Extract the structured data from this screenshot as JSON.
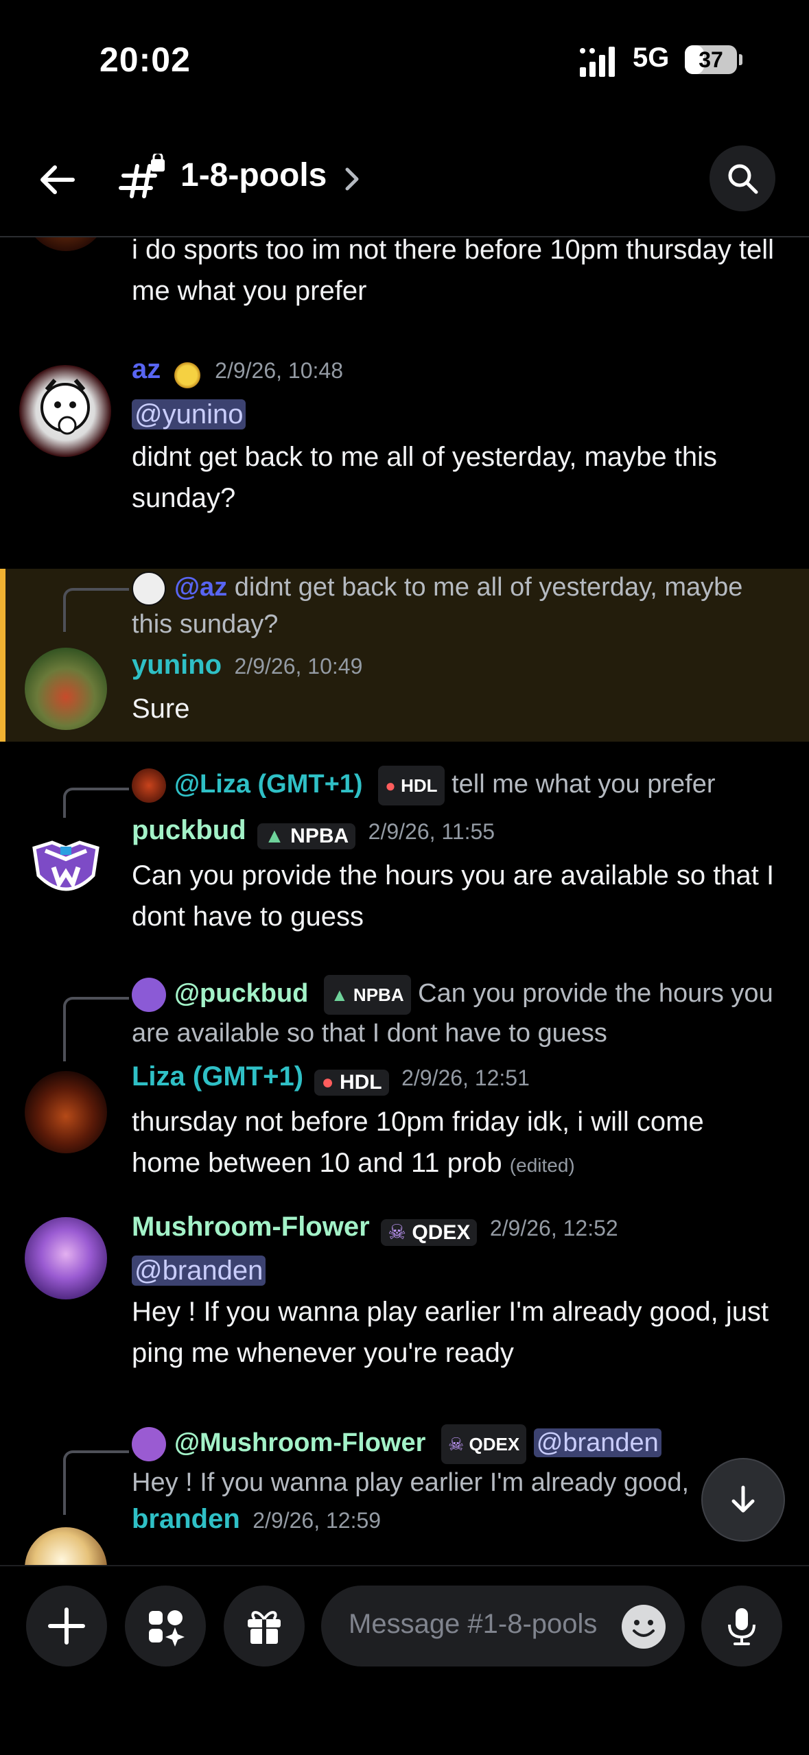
{
  "status_bar": {
    "time": "20:02",
    "network": "5G",
    "battery": "37",
    "battery_level": 0.37
  },
  "header": {
    "channel_name": "1-8-pools"
  },
  "colors": {
    "accent_yellow": "#f0b232",
    "mention_bg": "#3c4270",
    "name_teal": "#2fc0c6",
    "name_green": "#a3f2c8",
    "name_blue": "#5865f2"
  },
  "messages": [
    {
      "body": "i do sports too im not there before 10pm thursday tell me what you prefer"
    },
    {
      "author": "az",
      "timestamp": "2/9/26, 10:48",
      "mention": "@yunino",
      "body": "didnt get back to me all of yesterday, maybe this sunday?"
    },
    {
      "reply_to": "@az",
      "reply_text": "didnt get back to me all of yesterday, maybe this sunday?",
      "author": "yunino",
      "timestamp": "2/9/26, 10:49",
      "body": "Sure"
    },
    {
      "reply_to": "@Liza (GMT+1)",
      "reply_tag": "HDL",
      "reply_text": "tell me what you prefer",
      "author": "puckbud",
      "tag": "NPBA",
      "timestamp": "2/9/26, 11:55",
      "body": "Can you provide the hours you are available so that I dont have to guess"
    },
    {
      "reply_to": "@puckbud",
      "reply_tag": "NPBA",
      "reply_text": "Can you provide the hours you are available so that I dont have to guess",
      "author": "Liza (GMT+1)",
      "tag": "HDL",
      "timestamp": "2/9/26, 12:51",
      "body": "thursday not before 10pm friday idk, i will come home between 10 and 11 prob",
      "edited": "(edited)"
    },
    {
      "author": "Mushroom-Flower",
      "tag": "QDEX",
      "timestamp": "2/9/26, 12:52",
      "mention": "@branden",
      "body": "Hey ! If you wanna play earlier I'm already good, just ping me whenever you're ready"
    },
    {
      "reply_to": "@Mushroom-Flower",
      "reply_tag": "QDEX",
      "reply_mention": "@branden",
      "reply_text": "Hey ! If you wanna play earlier I'm already good, just pin",
      "author": "branden",
      "timestamp": "2/9/26, 12:59"
    }
  ],
  "composer": {
    "placeholder": "Message #1-8-pools"
  }
}
